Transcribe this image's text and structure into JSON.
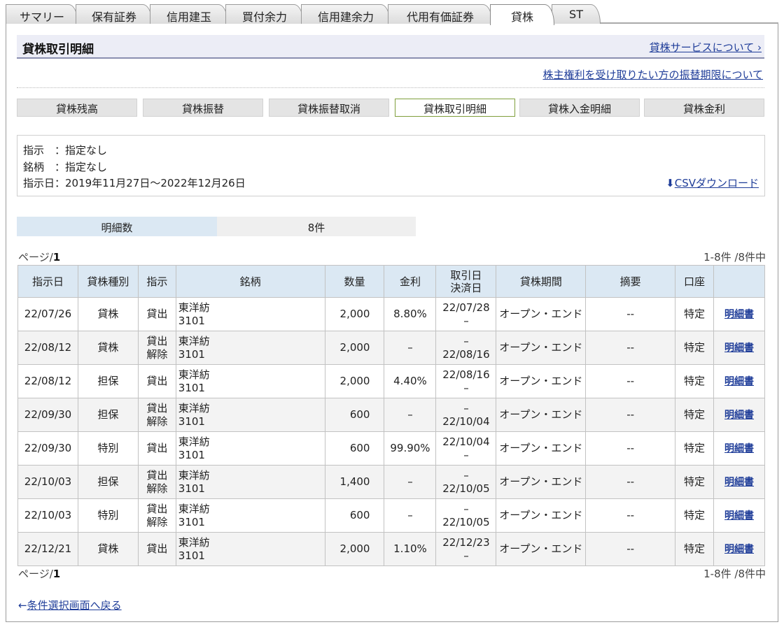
{
  "tabs": [
    {
      "label": "サマリー"
    },
    {
      "label": "保有証券"
    },
    {
      "label": "信用建玉"
    },
    {
      "label": "買付余力"
    },
    {
      "label": "信用建余力"
    },
    {
      "label": "代用有価証券"
    },
    {
      "label": "貸株"
    },
    {
      "label": "ST"
    }
  ],
  "header": {
    "title": "貸株取引明細",
    "service_link": "貸株サービスについて ›"
  },
  "rights_link": "株主権利を受け取りたい方の振替期限について",
  "subtabs": [
    {
      "label": "貸株残高"
    },
    {
      "label": "貸株振替"
    },
    {
      "label": "貸株振替取消"
    },
    {
      "label": "貸株取引明細"
    },
    {
      "label": "貸株入金明細"
    },
    {
      "label": "貸株金利"
    }
  ],
  "conditions": {
    "instruction": "指示　：指定なし",
    "stock": "銘柄　：指定なし",
    "date": "指示日：2019年11月27日～2022年12月26日",
    "csv_label": "CSVダウンロード"
  },
  "summary": {
    "label": "明細数",
    "value": "8件"
  },
  "pager": {
    "prefix": "ページ/",
    "page": "1",
    "range": "1-8件 /8件中"
  },
  "table": {
    "headers": {
      "date": "指示日",
      "type": "貸株種別",
      "instr": "指示",
      "stock": "銘柄",
      "qty": "数量",
      "rate": "金利",
      "trade_date": "取引日",
      "settle_date": "決済日",
      "period": "貸株期間",
      "summary": "摘要",
      "account": "口座"
    },
    "rows": [
      {
        "date": "22/07/26",
        "type": "貸株",
        "instr_a": "貸出",
        "instr_b": "",
        "name": "東洋紡",
        "code": "3101",
        "qty": "2,000",
        "rate": "8.80%",
        "d1": "22/07/28",
        "d2": "–",
        "period": "オープン・エンド",
        "summary": "--",
        "account": "特定",
        "link": "明細書"
      },
      {
        "date": "22/08/12",
        "type": "貸株",
        "instr_a": "貸出",
        "instr_b": "解除",
        "name": "東洋紡",
        "code": "3101",
        "qty": "2,000",
        "rate": "–",
        "d1": "–",
        "d2": "22/08/16",
        "period": "オープン・エンド",
        "summary": "--",
        "account": "特定",
        "link": "明細書"
      },
      {
        "date": "22/08/12",
        "type": "担保",
        "instr_a": "貸出",
        "instr_b": "",
        "name": "東洋紡",
        "code": "3101",
        "qty": "2,000",
        "rate": "4.40%",
        "d1": "22/08/16",
        "d2": "–",
        "period": "オープン・エンド",
        "summary": "--",
        "account": "特定",
        "link": "明細書"
      },
      {
        "date": "22/09/30",
        "type": "担保",
        "instr_a": "貸出",
        "instr_b": "解除",
        "name": "東洋紡",
        "code": "3101",
        "qty": "600",
        "rate": "–",
        "d1": "–",
        "d2": "22/10/04",
        "period": "オープン・エンド",
        "summary": "--",
        "account": "特定",
        "link": "明細書"
      },
      {
        "date": "22/09/30",
        "type": "特別",
        "instr_a": "貸出",
        "instr_b": "",
        "name": "東洋紡",
        "code": "3101",
        "qty": "600",
        "rate": "99.90%",
        "d1": "22/10/04",
        "d2": "–",
        "period": "オープン・エンド",
        "summary": "--",
        "account": "特定",
        "link": "明細書"
      },
      {
        "date": "22/10/03",
        "type": "担保",
        "instr_a": "貸出",
        "instr_b": "解除",
        "name": "東洋紡",
        "code": "3101",
        "qty": "1,400",
        "rate": "–",
        "d1": "–",
        "d2": "22/10/05",
        "period": "オープン・エンド",
        "summary": "--",
        "account": "特定",
        "link": "明細書"
      },
      {
        "date": "22/10/03",
        "type": "特別",
        "instr_a": "貸出",
        "instr_b": "解除",
        "name": "東洋紡",
        "code": "3101",
        "qty": "600",
        "rate": "–",
        "d1": "–",
        "d2": "22/10/05",
        "period": "オープン・エンド",
        "summary": "--",
        "account": "特定",
        "link": "明細書"
      },
      {
        "date": "22/12/21",
        "type": "貸株",
        "instr_a": "貸出",
        "instr_b": "",
        "name": "東洋紡",
        "code": "3101",
        "qty": "2,000",
        "rate": "1.10%",
        "d1": "22/12/23",
        "d2": "–",
        "period": "オープン・エンド",
        "summary": "--",
        "account": "特定",
        "link": "明細書"
      }
    ]
  },
  "back_link": "条件選択画面へ戻る",
  "colors": {
    "link": "#1f3d99",
    "header_bg": "#dbe8f3",
    "title_bg": "#ecedf6",
    "active_subtab_border": "#7f9f3c"
  }
}
